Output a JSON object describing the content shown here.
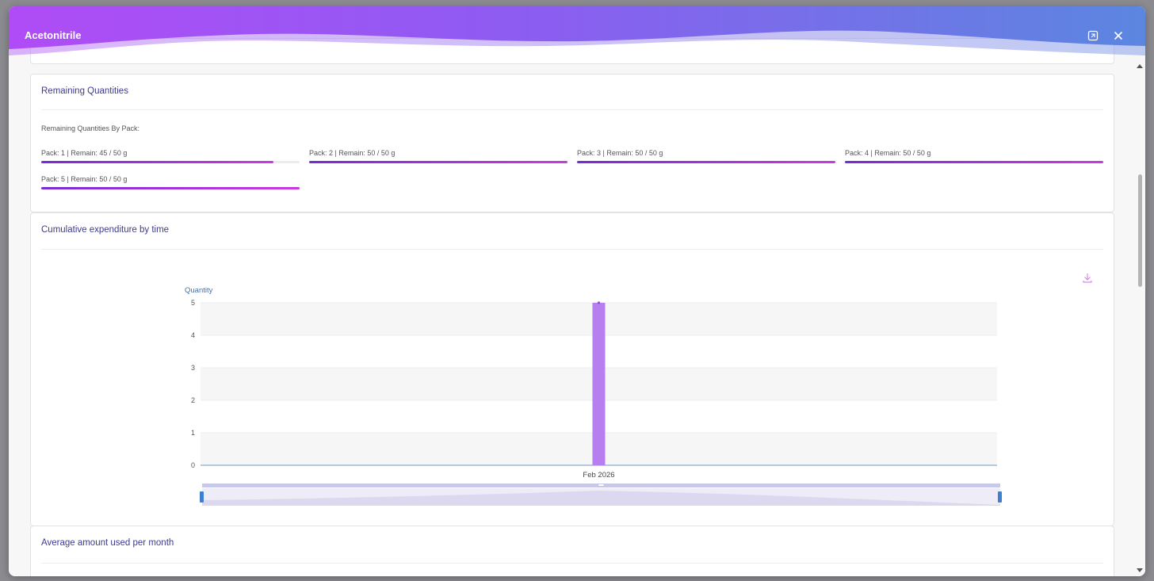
{
  "window": {
    "title": "Acetonitrile",
    "expand_icon": "expand-icon",
    "close_icon": "close-icon"
  },
  "remaining": {
    "title": "Remaining Quantities",
    "subtitle": "Remaining Quantities By Pack:",
    "packs": [
      {
        "label": "Pack: 1 | Remain: 45 / 50 g",
        "fraction": 0.9
      },
      {
        "label": "Pack: 2 | Remain: 50 / 50 g",
        "fraction": 1.0
      },
      {
        "label": "Pack: 3 | Remain: 50 / 50 g",
        "fraction": 1.0
      },
      {
        "label": "Pack: 4 | Remain: 50 / 50 g",
        "fraction": 1.0
      },
      {
        "label": "Pack: 5 | Remain: 50 / 50 g",
        "fraction": 1.0
      }
    ]
  },
  "cumulative": {
    "title": "Cumulative expenditure by time",
    "download_icon": "download-icon"
  },
  "average": {
    "title": "Average amount used per month"
  },
  "colors": {
    "accent": "#3f3a8e",
    "bar": "#b77ef0",
    "header_start": "#a64cf5",
    "header_end": "#5b86e0"
  },
  "chart_data": {
    "type": "bar",
    "categories": [
      "Feb 2026"
    ],
    "values": [
      5
    ],
    "ylabel": "Quantity",
    "xlabel": "",
    "ylim": [
      0,
      5
    ],
    "yticks": [
      "0",
      "1",
      "2",
      "3",
      "4",
      "5"
    ],
    "grid": true,
    "data_zoom": true
  }
}
